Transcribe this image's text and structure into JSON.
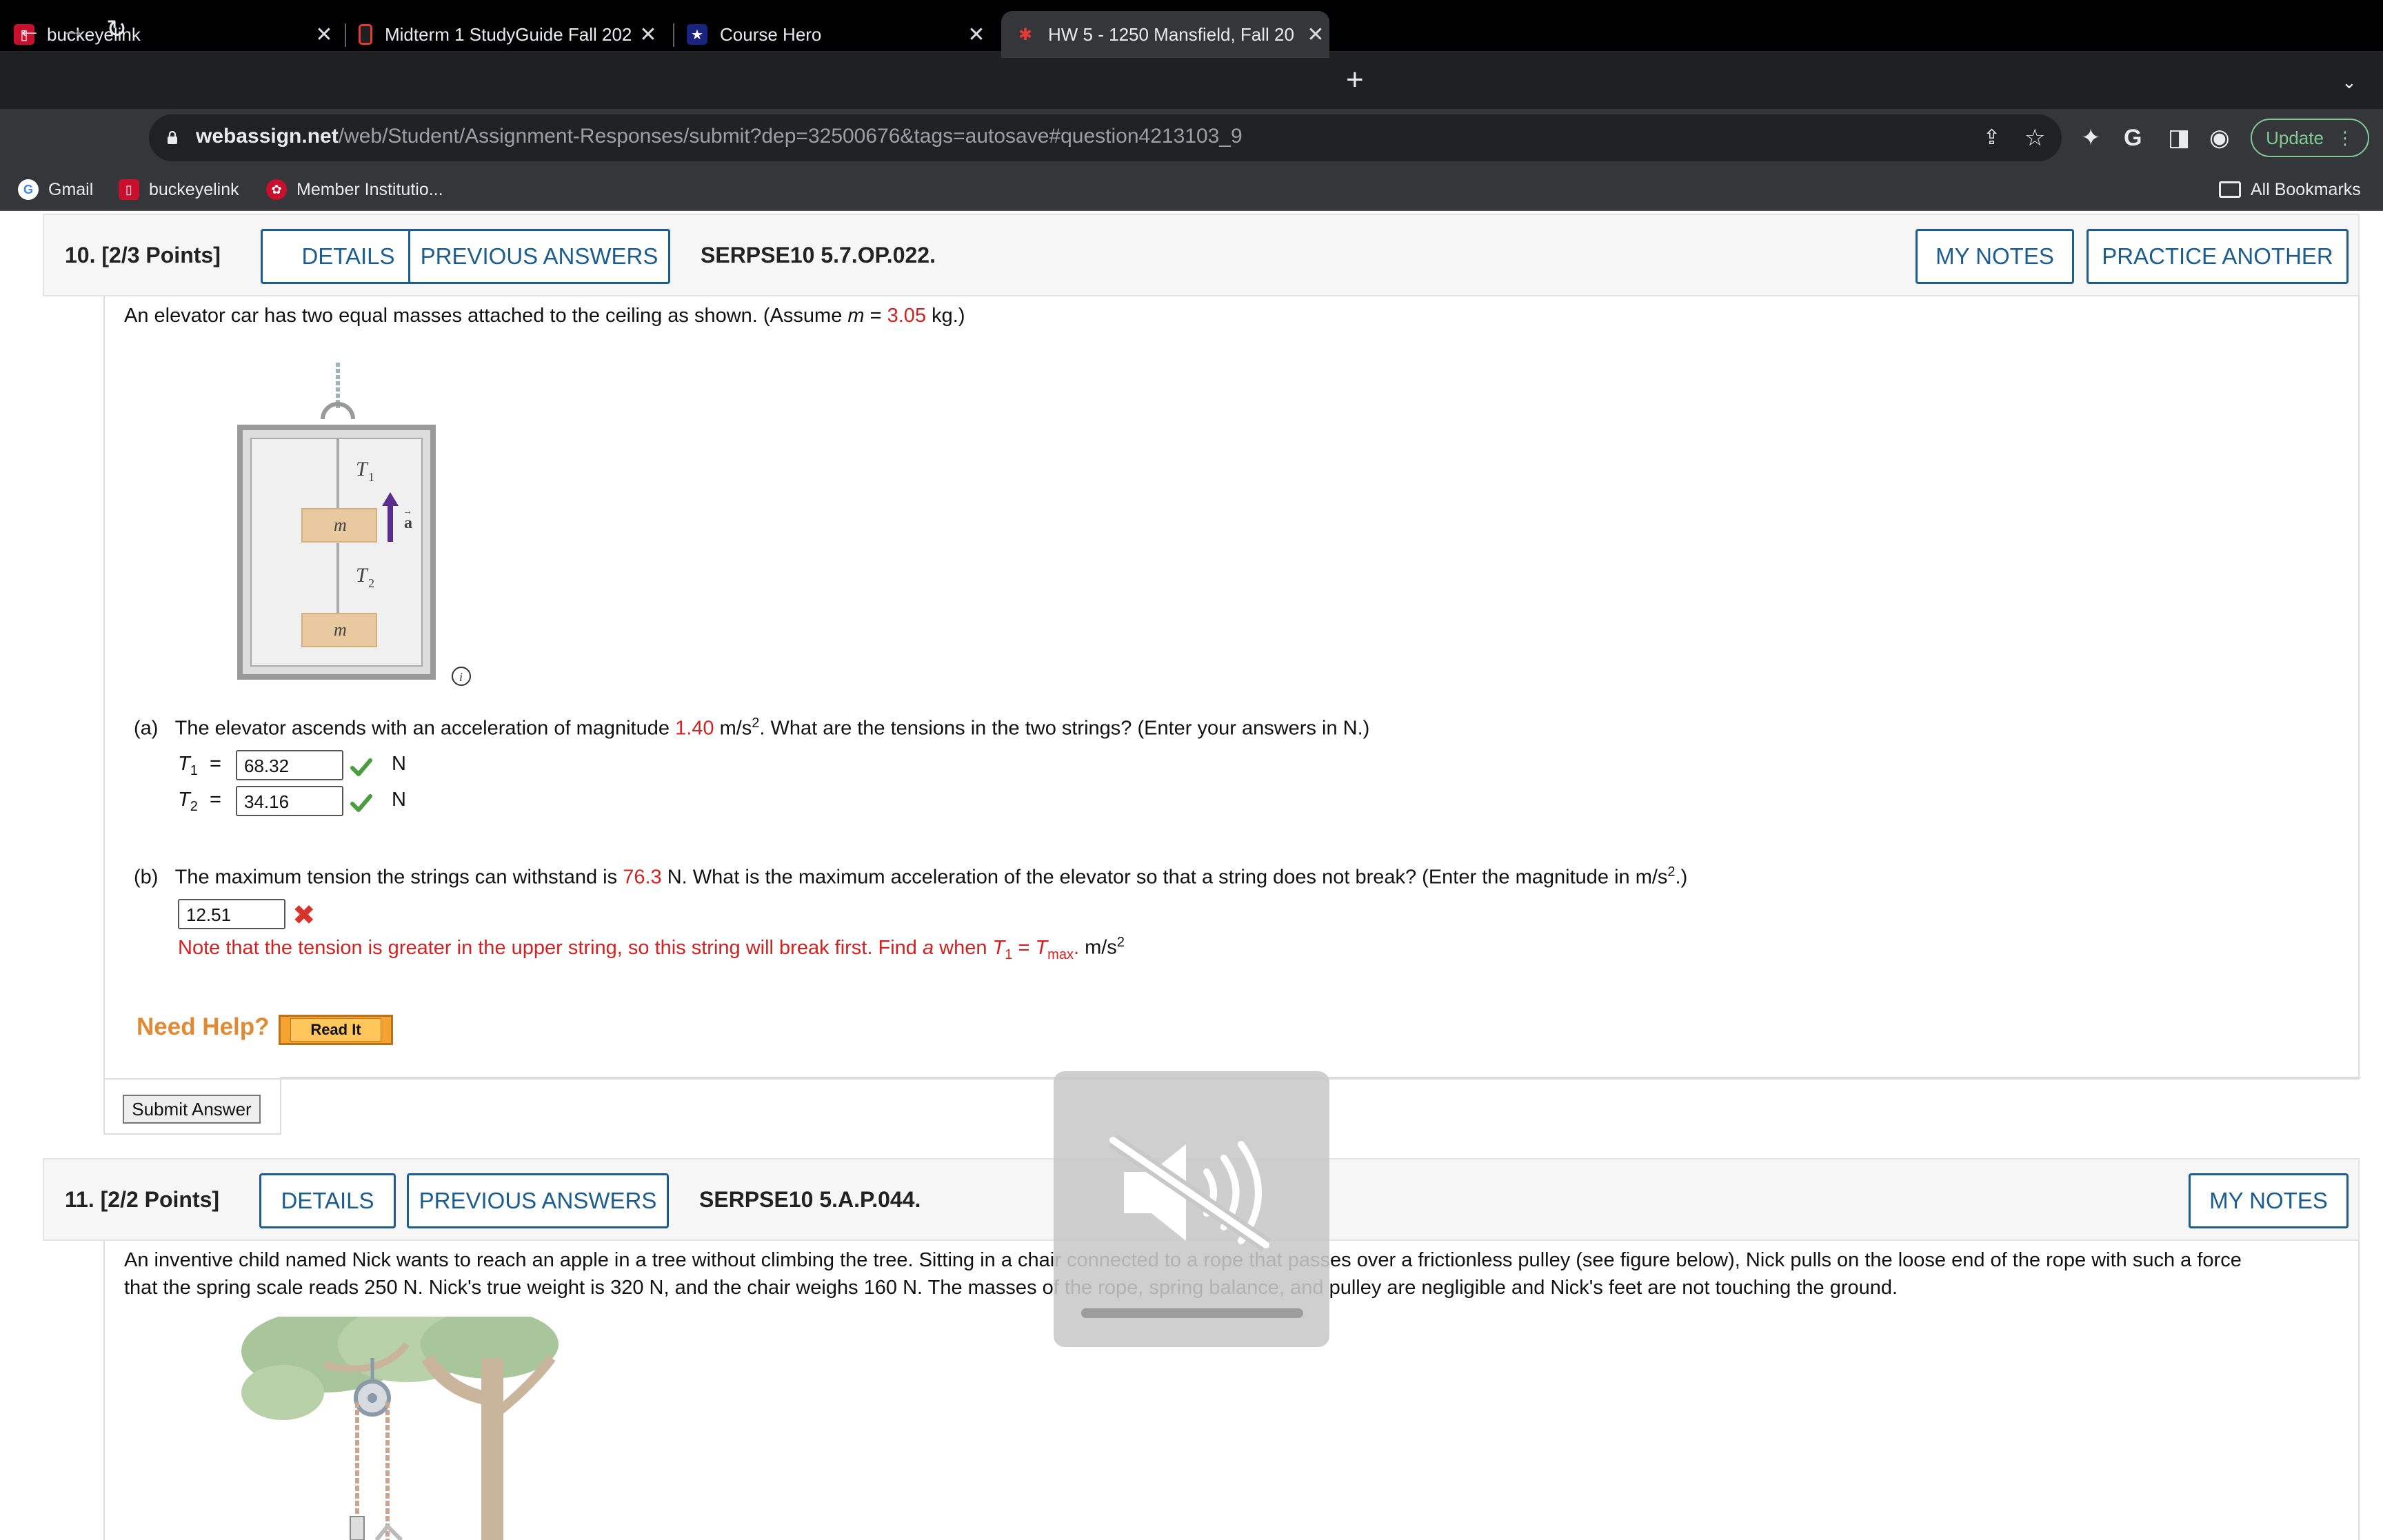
{
  "browser": {
    "tabs": [
      {
        "title": "buckeyelink",
        "favicon": "buckeyelink-icon"
      },
      {
        "title": "Midterm 1 StudyGuide Fall 202",
        "favicon": "document-icon"
      },
      {
        "title": "Course Hero",
        "favicon": "star-icon"
      },
      {
        "title": "HW 5 - 1250 Mansfield, Fall 20",
        "favicon": "webassign-icon"
      }
    ],
    "new_tab": "+",
    "url_host": "webassign.net",
    "url_path": "/web/Student/Assignment-Responses/submit?dep=32500676&tags=autosave#question4213103_9",
    "update_label": "Update",
    "bookmarks": [
      "Gmail",
      "buckeyelink",
      "Member Institutio..."
    ],
    "all_bookmarks": "All Bookmarks"
  },
  "q10": {
    "number": "10.  [2/3 Points]",
    "details": "DETAILS",
    "previous": "PREVIOUS ANSWERS",
    "code": "SERPSE10 5.7.OP.022.",
    "my_notes": "MY NOTES",
    "practice": "PRACTICE ANOTHER",
    "intro_pre": "An elevator car has two equal masses attached to the ceiling as shown. (Assume ",
    "intro_var": "m",
    "intro_eq": " = ",
    "intro_val": "3.05",
    "intro_post": " kg.)",
    "figure": {
      "t1": "T",
      "t1_sub": "1",
      "t2": "T",
      "t2_sub": "2",
      "mass": "m",
      "accel": "a"
    },
    "part_a": {
      "label": "(a)",
      "pre": "The elevator ascends with an acceleration of magnitude ",
      "val": "1.40",
      "unit_pre": " m/s",
      "unit_sup": "2",
      "post": ". What are the tensions in the two strings? (Enter your answers in N.)",
      "t1_var": "T",
      "t1_sub": "1",
      "t1_value": "68.32",
      "t2_var": "T",
      "t2_sub": "2",
      "t2_value": "34.16",
      "equals": "=",
      "unit": "N"
    },
    "part_b": {
      "label": "(b)",
      "pre": "The maximum tension the strings can withstand is ",
      "val": "76.3",
      "post": " N. What is the maximum acceleration of the elevator so that a string does not break? (Enter the magnitude in m/s",
      "sup": "2",
      "end": ".)",
      "answer": "12.51",
      "hint_pre": "Note that the tension is greater in the upper string, so this string will break first. Find ",
      "hint_a": "a",
      "hint_mid": " when ",
      "hint_t": "T",
      "hint_t_sub": "1",
      "hint_eq": " = ",
      "hint_tmax": "T",
      "hint_tmax_sub": "max",
      "hint_end": ".",
      "unit": " m/s",
      "unit_sup": "2"
    },
    "need_help": "Need Help?",
    "read_it": "Read It",
    "submit": "Submit Answer"
  },
  "q11": {
    "number": "11.  [2/2 Points]",
    "details": "DETAILS",
    "previous": "PREVIOUS ANSWERS",
    "code": "SERPSE10 5.A.P.044.",
    "my_notes": "MY NOTES",
    "line1": "An inventive child named Nick wants to reach an apple in a tree without climbing the tree. Sitting in a chair connected to a rope that passes over a frictionless pulley (see figure below), Nick pulls on the loose end of the rope with such a force",
    "line2": "that the spring scale reads 250 N. Nick's true weight is 320 N, and the chair weighs 160 N. The masses of the rope, spring balance, and pulley are negligible and Nick's feet are not touching the ground."
  },
  "overlay": {
    "icon": "muted-speaker-icon"
  },
  "colors": {
    "accent": "#1c5d8f",
    "red": "#d4201f",
    "help": "#e08a33"
  }
}
